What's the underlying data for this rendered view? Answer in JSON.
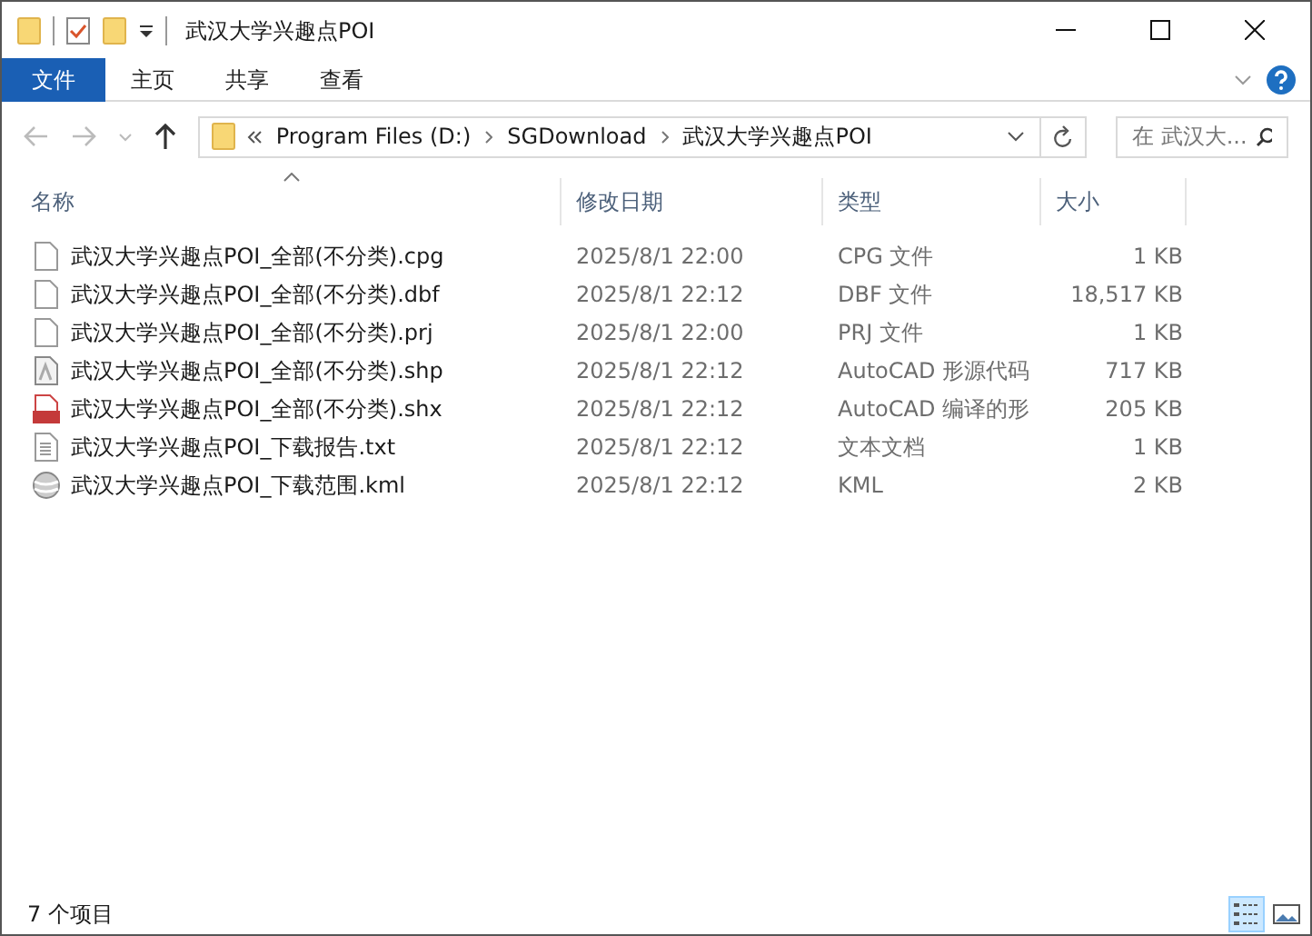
{
  "window": {
    "title": "武汉大学兴趣点POI"
  },
  "ribbon_tabs": [
    {
      "label": "文件",
      "selected": true
    },
    {
      "label": "主页",
      "selected": false
    },
    {
      "label": "共享",
      "selected": false
    },
    {
      "label": "查看",
      "selected": false
    }
  ],
  "breadcrumbs": [
    "Program Files (D:)",
    "SGDownload",
    "武汉大学兴趣点POI"
  ],
  "search": {
    "placeholder": "在 武汉大..."
  },
  "columns": [
    "名称",
    "修改日期",
    "类型",
    "大小"
  ],
  "files": [
    {
      "name": "武汉大学兴趣点POI_全部(不分类).cpg",
      "date": "2025/8/1 22:00",
      "type": "CPG 文件",
      "size": "1 KB",
      "kind": "blank"
    },
    {
      "name": "武汉大学兴趣点POI_全部(不分类).dbf",
      "date": "2025/8/1 22:12",
      "type": "DBF 文件",
      "size": "18,517 KB",
      "kind": "blank"
    },
    {
      "name": "武汉大学兴趣点POI_全部(不分类).prj",
      "date": "2025/8/1 22:00",
      "type": "PRJ 文件",
      "size": "1 KB",
      "kind": "blank"
    },
    {
      "name": "武汉大学兴趣点POI_全部(不分类).shp",
      "date": "2025/8/1 22:12",
      "type": "AutoCAD 形源代码",
      "size": "717 KB",
      "kind": "cad"
    },
    {
      "name": "武汉大学兴趣点POI_全部(不分类).shx",
      "date": "2025/8/1 22:12",
      "type": "AutoCAD 编译的形",
      "size": "205 KB",
      "kind": "shx"
    },
    {
      "name": "武汉大学兴趣点POI_下载报告.txt",
      "date": "2025/8/1 22:12",
      "type": "文本文档",
      "size": "1 KB",
      "kind": "text"
    },
    {
      "name": "武汉大学兴趣点POI_下载范围.kml",
      "date": "2025/8/1 22:12",
      "type": "KML",
      "size": "2 KB",
      "kind": "globe"
    }
  ],
  "status_bar": {
    "count": "7 个项目",
    "views": [
      {
        "kind": "details",
        "selected": true
      },
      {
        "kind": "large",
        "selected": false
      }
    ]
  }
}
